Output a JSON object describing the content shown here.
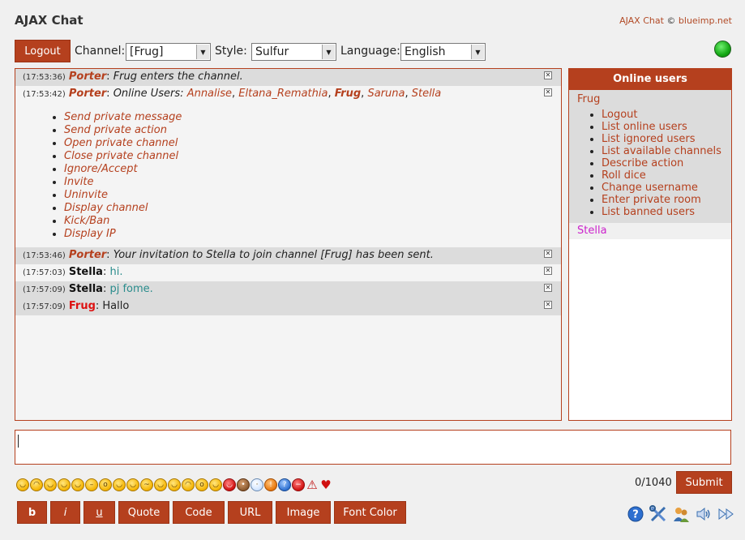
{
  "header": {
    "title": "AJAX Chat",
    "copyright_app": "AJAX Chat",
    "copyright_symbol": "©",
    "copyright_site": "blueimp.net"
  },
  "toolbar": {
    "logout_label": "Logout",
    "channel_label": "Channel:",
    "channel_value": "[Frug]",
    "style_label": "Style:",
    "style_value": "Sulfur",
    "language_label": "Language:",
    "language_value": "English",
    "status_color": "#14a814"
  },
  "messages": [
    {
      "ts": "(17:53:36)",
      "nick": "Porter",
      "text": "Frug enters the channel."
    },
    {
      "ts": "(17:53:42)",
      "nick": "Porter",
      "text_prefix": "Online Users:",
      "users": [
        "Annalise",
        "Eltana_Remathia",
        "Frug",
        "Saruna",
        "Stella"
      ],
      "menu": [
        "Send private message",
        "Send private action",
        "Open private channel",
        "Close private channel",
        "Ignore/Accept",
        "Invite",
        "Uninvite",
        "Display channel",
        "Kick/Ban",
        "Display IP"
      ]
    },
    {
      "ts": "(17:53:46)",
      "nick": "Porter",
      "text": "Your invitation to Stella to join channel [Frug] has been sent."
    },
    {
      "ts": "(17:57:03)",
      "nick": "Stella",
      "text": "hi."
    },
    {
      "ts": "(17:57:09)",
      "nick": "Stella",
      "text": "pj fome."
    },
    {
      "ts": "(17:57:09)",
      "nick": "Frug",
      "text": "Hallo"
    }
  ],
  "online_users": {
    "header": "Online users",
    "current_user": "Frug",
    "menu": [
      "Logout",
      "List online users",
      "List ignored users",
      "List available channels",
      "Describe action",
      "Roll dice",
      "Change username",
      "Enter private room",
      "List banned users"
    ],
    "other_user": "Stella"
  },
  "input": {
    "counter": "0/1040",
    "submit_label": "Submit"
  },
  "format_buttons": [
    "b",
    "i",
    "u",
    "Quote",
    "Code",
    "URL",
    "Image",
    "Font Color"
  ],
  "colors": {
    "accent": "#b5401e",
    "porter": "#b5401e",
    "frug": "#dd1111",
    "stella_list": "#cc22cc"
  }
}
